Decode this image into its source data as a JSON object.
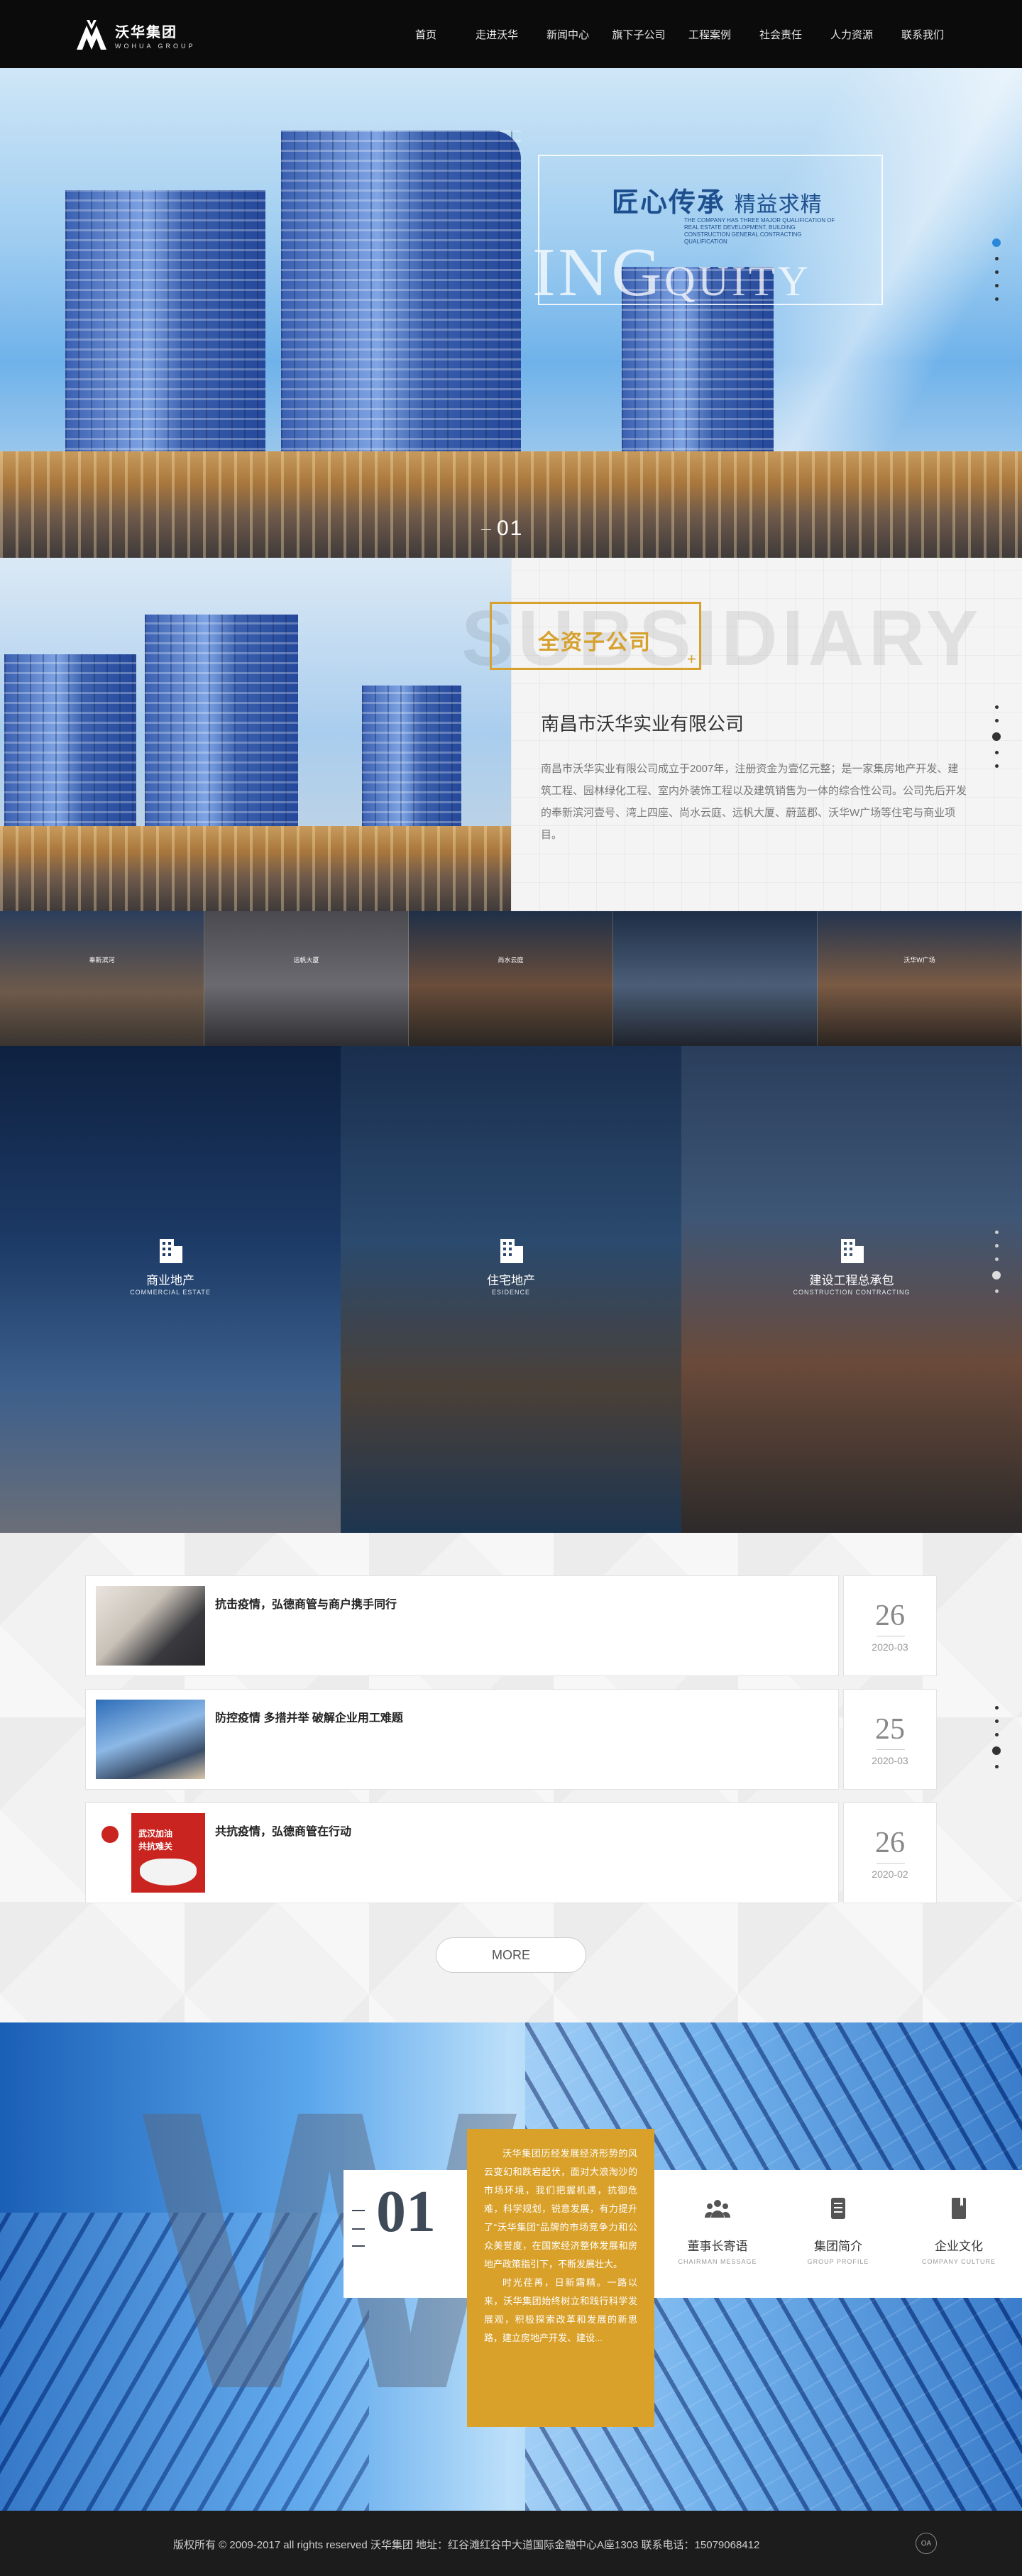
{
  "header": {
    "logo_cn": "沃华集团",
    "logo_en": "WOHUA GROUP",
    "nav": [
      "首页",
      "走进沃华",
      "新闻中心",
      "旗下子公司",
      "工程案例",
      "社会责任",
      "人力资源",
      "联系我们"
    ]
  },
  "hero": {
    "slogan_main": "匠心传承",
    "slogan_sub": "精益求精",
    "small_text": "THE COMPANY HAS THREE MAJOR QUALIFICATION OF REAL ESTATE DEVELOPMENT, BUILDING CONSTRUCTION GENERAL CONTRACTING QUALIFICATION",
    "big_en_a": "ING",
    "big_en_b": "QUITY",
    "index": "01"
  },
  "subsidiary": {
    "bg_en": "SUBSIDIARY",
    "tag": "全资子公司",
    "title": "南昌市沃华实业有限公司",
    "description": "南昌市沃华实业有限公司成立于2007年，注册资金为壹亿元整；是一家集房地产开发、建筑工程、园林绿化工程、室内外装饰工程以及建筑销售为一体的综合性公司。公司先后开发的奉新滨河壹号、湾上四座、尚水云庭、远帆大厦、蔚蓝郡、沃华W广场等住宅与商业项目。"
  },
  "strip": {
    "captions": [
      "奉新滨河",
      "远帆大厦",
      "尚水云庭",
      "",
      "沃华W广场"
    ]
  },
  "business": {
    "panels": [
      {
        "name": "商业地产",
        "en": "COMMERCIAL ESTATE"
      },
      {
        "name": "住宅地产",
        "en": "ESIDENCE"
      },
      {
        "name": "建设工程总承包",
        "en": "CONSTRUCTION CONTRACTING"
      }
    ]
  },
  "news": {
    "items": [
      {
        "title": "抗击疫情，弘德商管与商户携手同行",
        "day": "26",
        "month": "2020-03"
      },
      {
        "title": "防控疫情 多措并举 破解企业用工难题",
        "day": "25",
        "month": "2020-03"
      },
      {
        "title": "共抗疫情，弘德商管在行动",
        "day": "26",
        "month": "2020-02"
      }
    ],
    "thumb3_text_a": "武汉加油",
    "thumb3_text_b": "共抗难关",
    "more": "MORE"
  },
  "about": {
    "big_letter": "W",
    "number": "01",
    "paragraph_1": "沃华集团历经发展经济形势的风云变幻和跌宕起伏，面对大浪淘沙的市场环境，我们把握机遇，抗御危难，科学规划，锐意发展，有力提升了“沃华集团”品牌的市场竞争力和公众美誉度，在国家经济整体发展和房地产政策指引下，不断发展壮大。",
    "paragraph_2": "时光荏苒，日新霜精。一路以来，沃华集团始终树立和践行科学发展观，积极探索改革和发展的新思路，建立房地产开发、建设...",
    "links": [
      {
        "name": "董事长寄语",
        "en": "CHAIRMAN MESSAGE"
      },
      {
        "name": "集团简介",
        "en": "GROUP PROFILE"
      },
      {
        "name": "企业文化",
        "en": "COMPANY CULTURE"
      }
    ]
  },
  "footer": {
    "text": "版权所有 © 2009-2017 all rights reserved 沃华集团 地址：红谷滩红谷中大道国际金融中心A座1303 联系电话：15079068412",
    "badge": "OA"
  },
  "colors": {
    "accent_gold": "#d6a12e",
    "about_card": "#d9a12a",
    "active_dot": "#2a88d8",
    "header_bg": "#0b0b0b"
  }
}
